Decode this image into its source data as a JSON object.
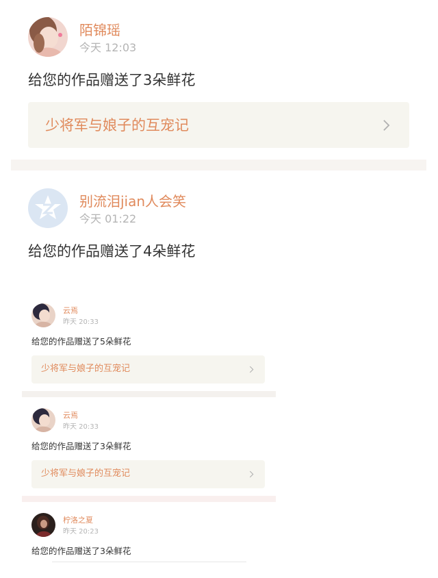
{
  "entries_large": [
    {
      "user": "陌锦瑶",
      "time": "今天 12:03",
      "message": "给您的作品赠送了3朵鲜花",
      "work_title": "少将军与娘子的互宠记",
      "avatar_icon": "user-photo-avatar"
    },
    {
      "user": "别流泪jian人会笑",
      "time": "今天 01:22",
      "message": "给您的作品赠送了4朵鲜花",
      "avatar_icon": "default-star-avatar"
    }
  ],
  "entries_small": [
    {
      "user": "云焉",
      "time": "昨天 20:33",
      "message": "给您的作品赠送了5朵鲜花",
      "work_title": "少将军与娘子的互宠记",
      "avatar_icon": "user-photo-avatar"
    },
    {
      "user": "云焉",
      "time": "昨天 20:33",
      "message": "给您的作品赠送了3朵鲜花",
      "work_title": "少将军与娘子的互宠记",
      "avatar_icon": "user-photo-avatar"
    },
    {
      "user": "柠洛之夏",
      "time": "昨天 20:23",
      "message": "给您的作品赠送了3朵鲜花",
      "avatar_icon": "user-photo-avatar"
    }
  ],
  "colors": {
    "username": "#e08a5c",
    "timestamp": "#b4b4b4",
    "card_bg": "#f6f5ef",
    "message": "#333333"
  }
}
